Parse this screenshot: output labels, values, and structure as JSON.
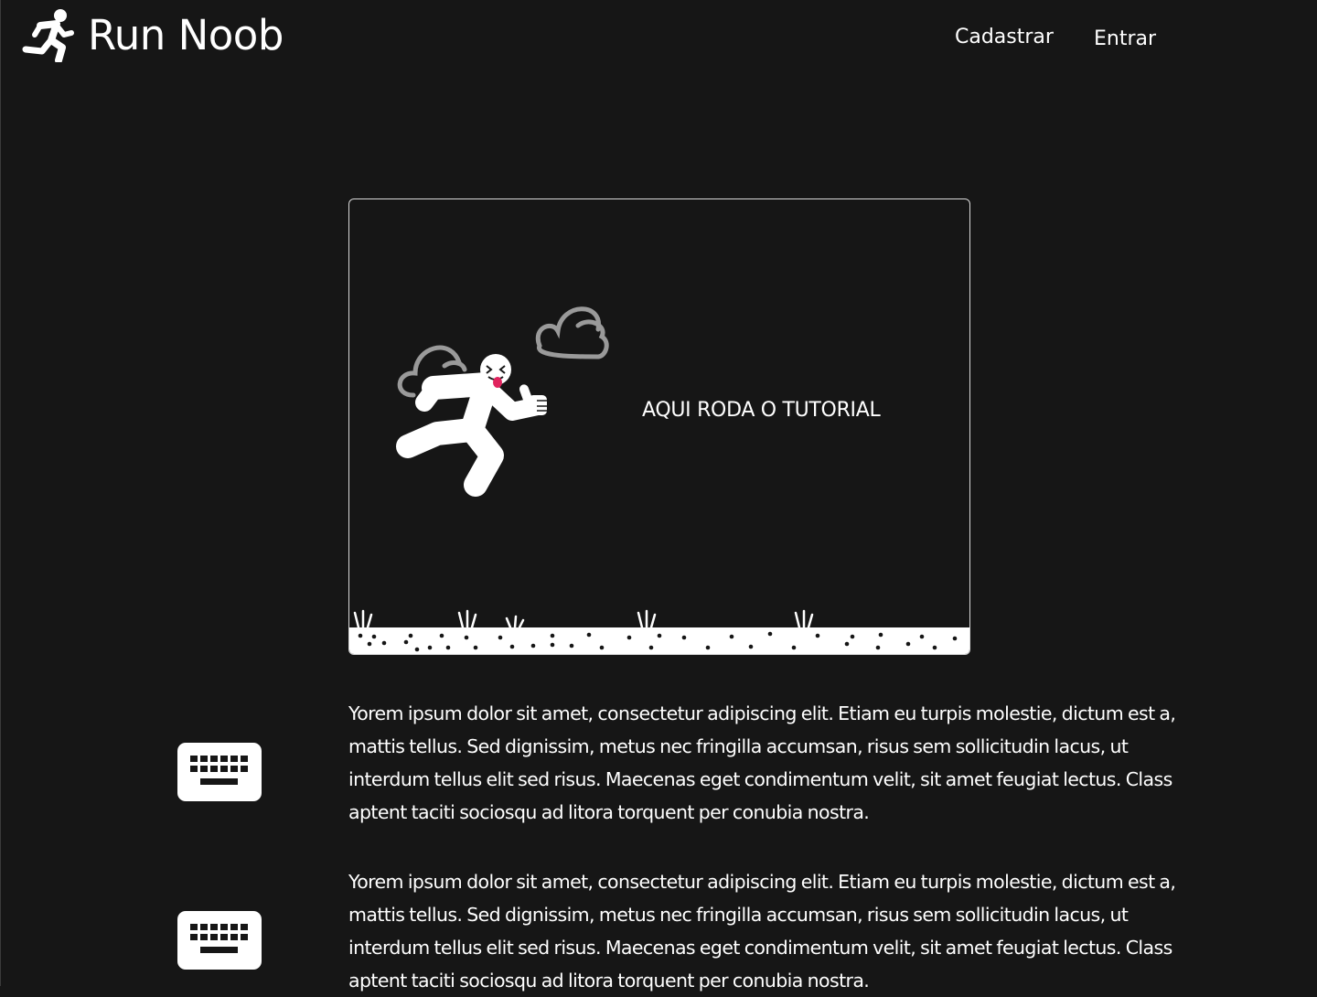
{
  "header": {
    "brand": "Run Noob",
    "brand_icon": "running-person-icon",
    "nav": {
      "signup": "Cadastrar",
      "login": "Entrar"
    }
  },
  "tutorial": {
    "caption": "AQUI RODA O TUTORIAL",
    "illustration": "running-noob-character"
  },
  "instructions": [
    {
      "icon": "keyboard-icon",
      "text": "Yorem ipsum dolor sit amet, consectetur adipiscing elit. Etiam eu turpis molestie, dictum est a, mattis tellus. Sed dignissim, metus nec fringilla accumsan, risus sem sollicitudin lacus, ut interdum tellus elit sed risus. Maecenas eget condimentum velit, sit amet feugiat lectus. Class aptent taciti sociosqu ad litora torquent per conubia nostra."
    },
    {
      "icon": "keyboard-icon",
      "text": "Yorem ipsum dolor sit amet, consectetur adipiscing elit. Etiam eu turpis molestie, dictum est a, mattis tellus. Sed dignissim, metus nec fringilla accumsan, risus sem sollicitudin lacus, ut interdum tellus elit sed risus. Maecenas eget condimentum velit, sit amet feugiat lectus. Class aptent taciti sociosqu ad litora torquent per conubia nostra."
    }
  ],
  "colors": {
    "background": "#161616",
    "foreground": "#ffffff",
    "cloud": "#9a9a9a",
    "tongue": "#e0245e"
  }
}
